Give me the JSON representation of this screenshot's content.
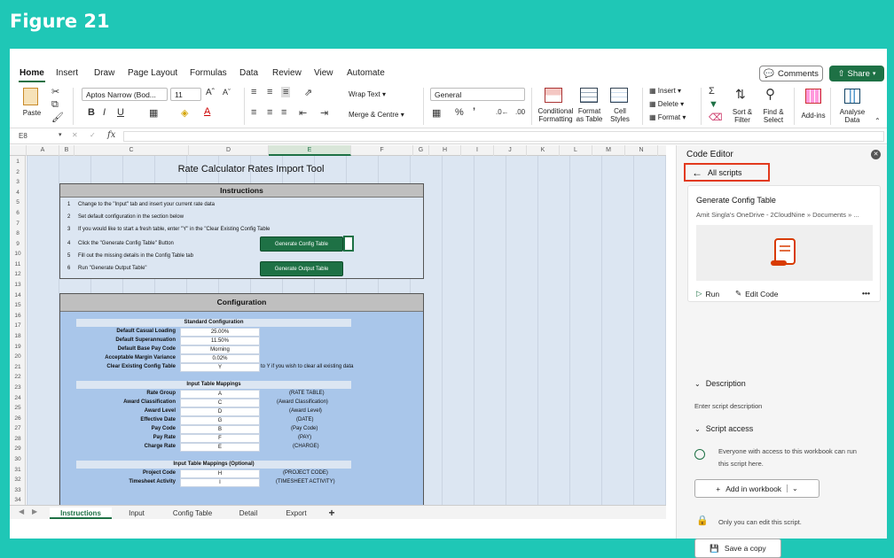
{
  "figure_title": "Figure 21",
  "menu": {
    "tabs": [
      "Home",
      "Insert",
      "Draw",
      "Page Layout",
      "Formulas",
      "Data",
      "Review",
      "View",
      "Automate"
    ],
    "comments": "Comments",
    "share": "Share"
  },
  "ribbon": {
    "paste": "Paste",
    "font_name": "Aptos Narrow (Bod...",
    "font_size": "11",
    "wrap_text": "Wrap Text",
    "merge_centre": "Merge & Centre",
    "number_format": "General",
    "conditional_formatting": [
      "Conditional",
      "Formatting"
    ],
    "format_as_table": [
      "Format",
      "as Table"
    ],
    "cell_styles": [
      "Cell",
      "Styles"
    ],
    "insert": "Insert",
    "delete": "Delete",
    "format": "Format",
    "sort_filter": [
      "Sort &",
      "Filter"
    ],
    "find_select": [
      "Find &",
      "Select"
    ],
    "add_ins": "Add-ins",
    "analyse_data": [
      "Analyse",
      "Data"
    ]
  },
  "formula_bar": {
    "name_box": "E8",
    "fx": "fx"
  },
  "grid": {
    "columns": [
      "A",
      "B",
      "C",
      "D",
      "E",
      "F",
      "G",
      "H",
      "I",
      "J",
      "K",
      "L",
      "M",
      "N"
    ],
    "rows": [
      "1",
      "2",
      "3",
      "4",
      "5",
      "6",
      "7",
      "8",
      "9",
      "10",
      "11",
      "12",
      "13",
      "14",
      "15",
      "16",
      "17",
      "18",
      "19",
      "20",
      "21",
      "22",
      "23",
      "24",
      "25",
      "26",
      "27",
      "28",
      "29",
      "30",
      "31",
      "32",
      "33",
      "34"
    ],
    "title": "Rate Calculator Rates Import Tool",
    "instructions": {
      "header": "Instructions",
      "steps": [
        {
          "n": "1",
          "text": "Change to the \"Input\" tab and insert your current rate data"
        },
        {
          "n": "2",
          "text": "Set default configuration in the section below"
        },
        {
          "n": "3",
          "text": "If you would like to start a fresh table, enter \"Y\" in the \"Clear Existing Config Table"
        },
        {
          "n": "4",
          "text": " Click the \"Generate Config Table\" Button"
        },
        {
          "n": "5",
          "text": "Fill out the missing details in the Config Table tab"
        },
        {
          "n": "6",
          "text": "Run \"Generate Output Table\""
        }
      ],
      "btn_generate_config": "Generate Config Table",
      "btn_generate_output": "Generate Output Table"
    },
    "configuration": {
      "header": "Configuration",
      "standard_header": "Standard Configuration",
      "standard": [
        {
          "label": "Default Casual Loading",
          "value": "25.00%"
        },
        {
          "label": "Default Superannuation",
          "value": "11.50%"
        },
        {
          "label": "Default Base Pay Code",
          "value": "Morning"
        },
        {
          "label": "Acceptable Margin Variance",
          "value": "0.02%"
        },
        {
          "label": "Clear Existing Config Table",
          "value": "Y"
        }
      ],
      "clear_note": "to Y if you wish to clear all existing data",
      "mappings_header": "Input Table Mappings",
      "mappings": [
        {
          "label": "Rate Group",
          "value": "A",
          "note": "(RATE TABLE)"
        },
        {
          "label": "Award Classification",
          "value": "C",
          "note": "(Award Classification)"
        },
        {
          "label": "Award Level",
          "value": "D",
          "note": "(Award Level)"
        },
        {
          "label": "Effective Date",
          "value": "G",
          "note": "(DATE)"
        },
        {
          "label": "Pay Code",
          "value": "B",
          "note": "(Pay Code)"
        },
        {
          "label": "Pay Rate",
          "value": "F",
          "note": "(PAY)"
        },
        {
          "label": "Charge Rate",
          "value": "E",
          "note": "(CHARGE)"
        }
      ],
      "optional_header": "Input Table Mappings (Optional)",
      "optional": [
        {
          "label": "Project Code",
          "value": "H",
          "note": "(PROJECT CODE)"
        },
        {
          "label": "Timesheet Activity",
          "value": "I",
          "note": "(TIMESHEET ACTIVITY)"
        }
      ]
    }
  },
  "sheet_tabs": [
    "Instructions",
    "Input",
    "Config Table",
    "Detail",
    "Export"
  ],
  "code_editor": {
    "title": "Code Editor",
    "all_scripts": "All scripts",
    "script_name": "Generate Config Table",
    "script_path": "Amit Singla's OneDrive - 2CloudNine » Documents » ...",
    "run": "Run",
    "edit_code": "Edit Code",
    "more": "•••",
    "description_label": "Description",
    "description_placeholder": "Enter script description",
    "script_access_label": "Script access",
    "access_text_1": "Everyone with access to this workbook can run",
    "access_text_2": "this script here.",
    "add_in_workbook": "Add in workbook",
    "edit_note": "Only you can edit this script.",
    "save_copy": "Save a copy"
  },
  "colors": {
    "accent": "#1e7145",
    "highlight_border": "#e23a1e",
    "background": "#1fc7b6"
  }
}
